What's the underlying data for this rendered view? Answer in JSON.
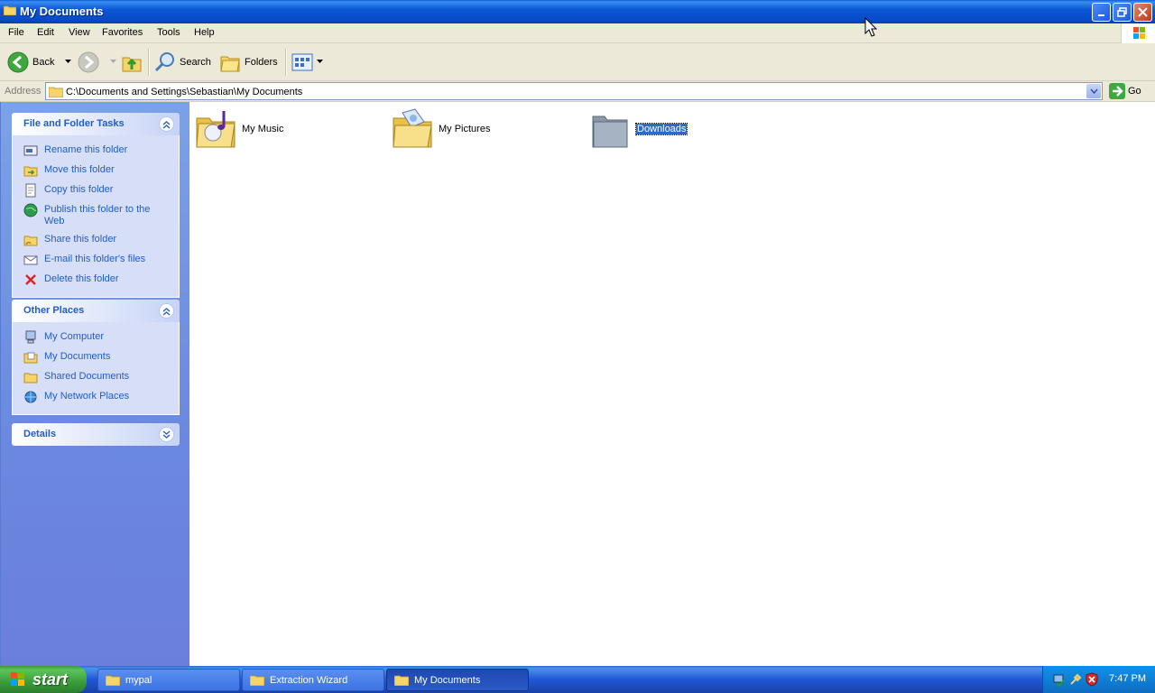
{
  "window": {
    "title": "My Documents"
  },
  "menu": [
    "File",
    "Edit",
    "View",
    "Favorites",
    "Tools",
    "Help"
  ],
  "toolbar": {
    "back": "Back",
    "search": "Search",
    "folders": "Folders"
  },
  "address": {
    "label": "Address",
    "path": "C:\\Documents and Settings\\Sebastian\\My Documents",
    "go": "Go"
  },
  "tasks": {
    "file_folder": {
      "title": "File and Folder Tasks",
      "items": [
        "Rename this folder",
        "Move this folder",
        "Copy this folder",
        "Publish this folder to the Web",
        "Share this folder",
        "E-mail this folder's files",
        "Delete this folder"
      ]
    },
    "other_places": {
      "title": "Other Places",
      "items": [
        "My Computer",
        "My Documents",
        "Shared Documents",
        "My Network Places"
      ]
    },
    "details": {
      "title": "Details"
    }
  },
  "folders": [
    {
      "name": "My Music",
      "icon": "music-folder-icon"
    },
    {
      "name": "My Pictures",
      "icon": "pictures-folder-icon"
    },
    {
      "name": "Downloads",
      "icon": "folder-icon",
      "selected": true
    }
  ],
  "taskbar": {
    "start": "start",
    "tasks": [
      "mypal",
      "Extraction Wizard",
      "My Documents"
    ],
    "clock": "7:47 PM"
  }
}
